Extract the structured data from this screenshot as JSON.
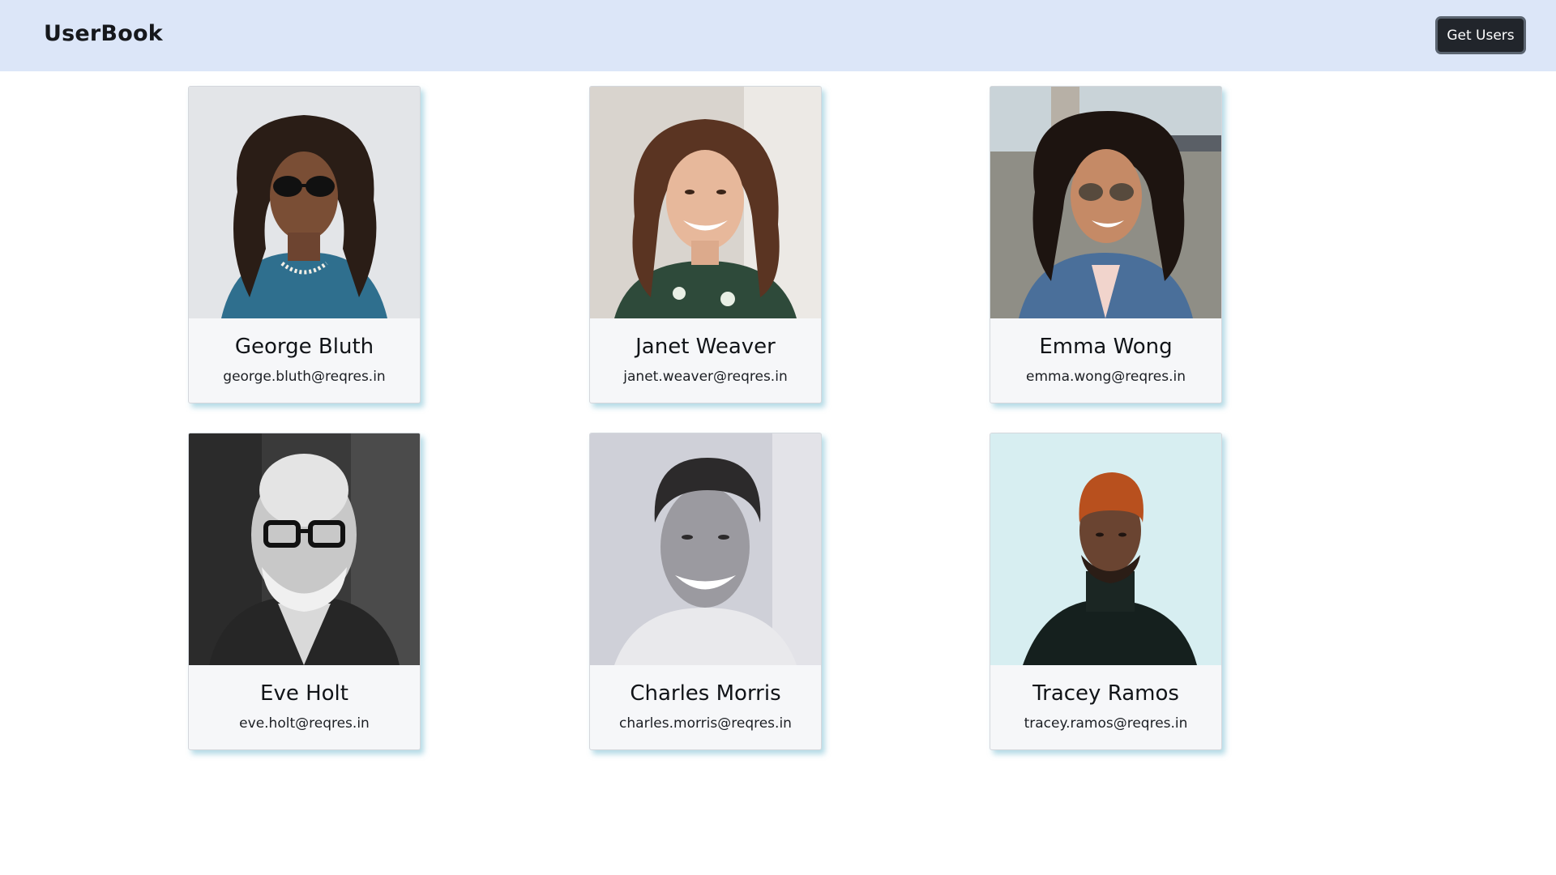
{
  "header": {
    "brand": "UserBook",
    "button_label": "Get Users"
  },
  "users": [
    {
      "name": "George Bluth",
      "email": "george.bluth@reqres.in"
    },
    {
      "name": "Janet Weaver",
      "email": "janet.weaver@reqres.in"
    },
    {
      "name": "Emma Wong",
      "email": "emma.wong@reqres.in"
    },
    {
      "name": "Eve Holt",
      "email": "eve.holt@reqres.in"
    },
    {
      "name": "Charles Morris",
      "email": "charles.morris@reqres.in"
    },
    {
      "name": "Tracey Ramos",
      "email": "tracey.ramos@reqres.in"
    }
  ],
  "colors": {
    "navbar_bg": "#dce6f8",
    "button_bg": "#21252b",
    "card_bg": "#f6f7f9",
    "card_shadow": "#78bed2"
  }
}
